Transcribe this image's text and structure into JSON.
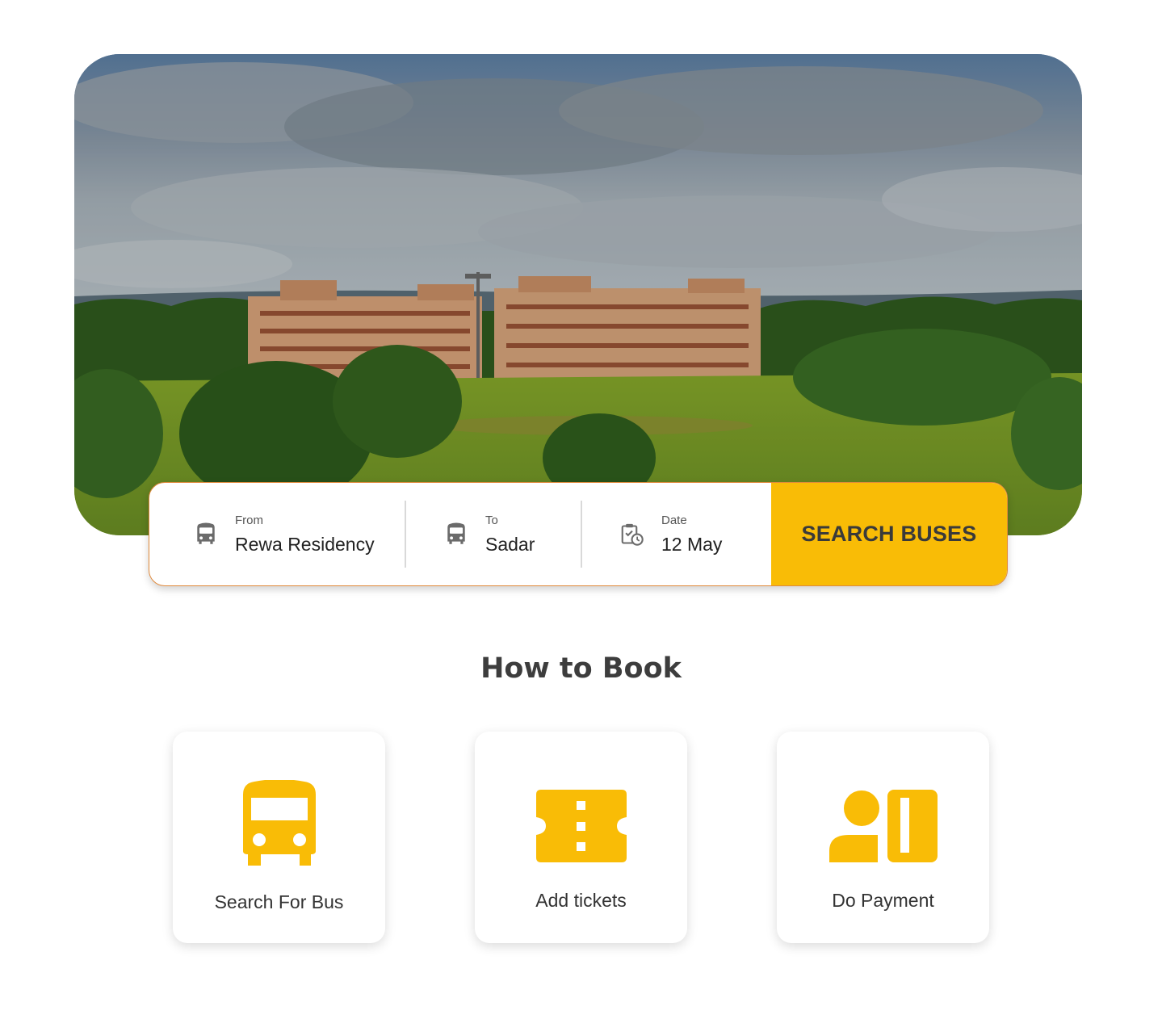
{
  "search": {
    "from_label": "From",
    "from_value": "Rewa Residency",
    "to_label": "To",
    "to_value": "Sadar",
    "date_label": "Date",
    "date_value": "12 May",
    "button_label": "SEARCH BUSES"
  },
  "how_to_book": {
    "title": "How to Book",
    "steps": [
      {
        "label": "Search For Bus",
        "icon": "bus-icon"
      },
      {
        "label": "Add tickets",
        "icon": "ticket-icon"
      },
      {
        "label": "Do Payment",
        "icon": "payment-icon"
      }
    ]
  },
  "colors": {
    "accent": "#f9bc06",
    "border": "#e08a3c",
    "text": "#333333"
  }
}
